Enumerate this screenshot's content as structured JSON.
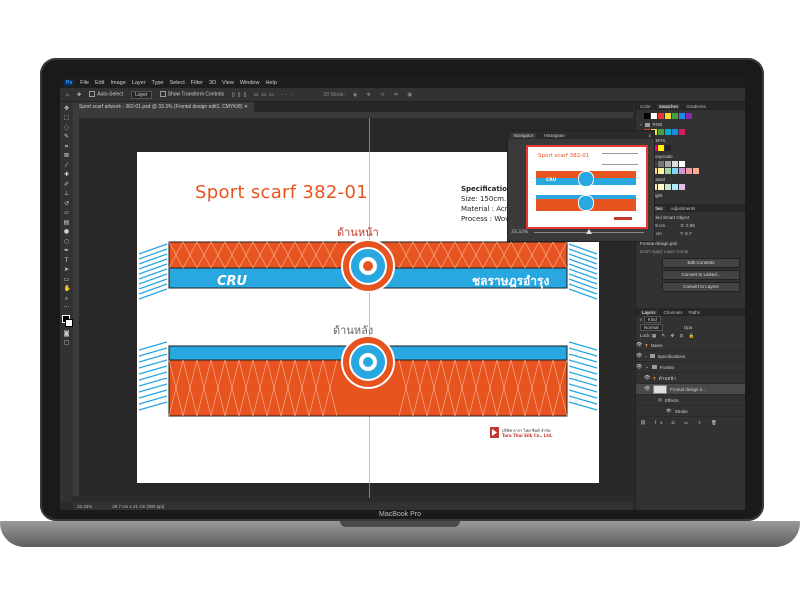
{
  "device": {
    "brand": "MacBook Pro"
  },
  "menubar": {
    "app_badge": "Ps",
    "items": [
      "File",
      "Edit",
      "Image",
      "Layer",
      "Type",
      "Select",
      "Filter",
      "3D",
      "View",
      "Window",
      "Help"
    ]
  },
  "options_bar": {
    "auto_select": "Auto-Select",
    "target": "Layer",
    "transform": "Show Transform Controls",
    "mode3d": "3D Mode:"
  },
  "document_tab": {
    "label": "Sport scarf artwork - 382-01.psd @ 33.3% (Frontal design edit1, CMYK/8)"
  },
  "status_bar": {
    "zoom": "33.33%",
    "dimensions": "29.7 cm x 21 cm (300 ppi)"
  },
  "artboard": {
    "title": "Sport scarf 382-01",
    "spec_title": "Specification",
    "spec_lines": [
      "Size: 150cm. L",
      "Material : Acr",
      "Process : Wov"
    ],
    "front_label": "ด้านหน้า",
    "back_label": "ด้านหลัง",
    "scarf_left_text": "CRU",
    "scarf_right_text": "ชลราษฎรอำรุง",
    "company_th": "บริษัท ธารา ไทย ซิลค์ จำกัด",
    "company_en": "Tara Thai Silk Co., Ltd."
  },
  "navigator": {
    "tabs": [
      "Navigator",
      "Histogram"
    ],
    "zoom": "33.33%",
    "thumb_title": "Sport scarf 382-01",
    "thumb_left": "CRU"
  },
  "swatches_panel": {
    "tabs": [
      "Color",
      "Swatches",
      "Gradients"
    ],
    "groups": [
      "RGB",
      "CMYK",
      "Grayscale",
      "Pastel",
      "Light"
    ]
  },
  "properties_panel": {
    "tabs": [
      "Properties",
      "Adjustments"
    ],
    "type": "Embedded Smart Object",
    "w": "W:  20.76 cm",
    "x": "X:  2.98",
    "h": "H:  1.95 cm",
    "y": "Y:  5.7",
    "file": "Frontal design.psb",
    "layer_comp": "Don't Apply Layer Comp",
    "buttons": [
      "Edit Contents",
      "Convert to Linked...",
      "Convert to Layers"
    ]
  },
  "layers_panel": {
    "tabs": [
      "Layers",
      "Channels",
      "Paths"
    ],
    "kind": "Kind",
    "blend": "Normal",
    "opacity": "Opa",
    "lock": "Lock:",
    "layers": [
      {
        "name": "Name",
        "kind": "text"
      },
      {
        "name": "Specifications",
        "kind": "folder"
      },
      {
        "name": "Frontal",
        "kind": "folder"
      },
      {
        "name": "ด้านหน้า",
        "kind": "text"
      },
      {
        "name": "Frontal design e...",
        "kind": "smart"
      },
      {
        "name": "Effects",
        "kind": "fx"
      },
      {
        "name": "Stroke",
        "kind": "fx"
      }
    ]
  },
  "colors": {
    "scarf_orange": "#e8541f",
    "scarf_blue": "#29a7e1",
    "accent_red": "#c0392b"
  }
}
